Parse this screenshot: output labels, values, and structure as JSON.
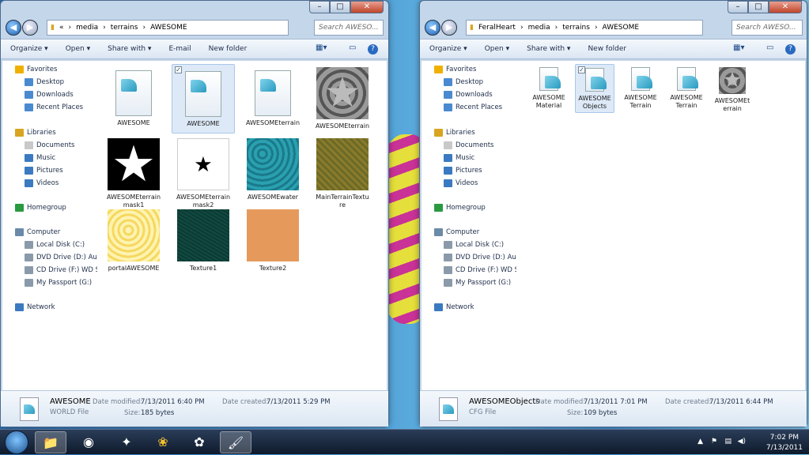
{
  "left": {
    "path": [
      "«",
      "media",
      "terrains",
      "AWESOME"
    ],
    "search_placeholder": "Search AWESO...",
    "toolbar": {
      "organize": "Organize ▾",
      "open": "Open ▾",
      "share": "Share with ▾",
      "email": "E-mail",
      "newfolder": "New folder"
    },
    "nav": {
      "favorites": "Favorites",
      "desktop": "Desktop",
      "downloads": "Downloads",
      "recent": "Recent Places",
      "libraries": "Libraries",
      "documents": "Documents",
      "music": "Music",
      "pictures": "Pictures",
      "videos": "Videos",
      "homegroup": "Homegroup",
      "computer": "Computer",
      "localdisk": "Local Disk (C:)",
      "dvd": "DVD Drive (D:) Audi",
      "cd": "CD Drive (F:) WD Sm",
      "passport": "My Passport (G:)",
      "network": "Network"
    },
    "files": [
      {
        "name": "AWESOME",
        "type": "doc"
      },
      {
        "name": "AWESOME",
        "type": "doc"
      },
      {
        "name": "AWESOMEterrain",
        "type": "doc"
      },
      {
        "name": "AWESOMEterrain",
        "type": "stars"
      },
      {
        "name": "AWESOMEterrain\nmask1",
        "type": "bigstar"
      },
      {
        "name": "AWESOMEterrain\nmask2",
        "type": "smallstar"
      },
      {
        "name": "AWESOMEwater",
        "type": "water"
      },
      {
        "name": "MainTerrainTextu\nre",
        "type": "grass"
      },
      {
        "name": "portalAWESOME",
        "type": "portal"
      },
      {
        "name": "Texture1",
        "type": "darkteal"
      },
      {
        "name": "Texture2",
        "type": "orange"
      }
    ],
    "details": {
      "name": "AWESOME",
      "type": "WORLD File",
      "modified_label": "Date modified:",
      "modified": "7/13/2011 6:40 PM",
      "created_label": "Date created:",
      "created": "7/13/2011 5:29 PM",
      "size_label": "Size:",
      "size": "185 bytes"
    }
  },
  "right": {
    "path": [
      "FeralHeart",
      "media",
      "terrains",
      "AWESOME"
    ],
    "search_placeholder": "Search AWESO...",
    "toolbar": {
      "organize": "Organize ▾",
      "open": "Open ▾",
      "share": "Share with ▾",
      "newfolder": "New folder"
    },
    "nav": {
      "favorites": "Favorites",
      "desktop": "Desktop",
      "downloads": "Downloads",
      "recent": "Recent Places",
      "libraries": "Libraries",
      "documents": "Documents",
      "music": "Music",
      "pictures": "Pictures",
      "videos": "Videos",
      "homegroup": "Homegroup",
      "computer": "Computer",
      "localdisk": "Local Disk (C:)",
      "dvd": "DVD Drive (D:) Audi",
      "cd": "CD Drive (F:) WD Sm",
      "passport": "My Passport (G:)",
      "network": "Network"
    },
    "files": [
      {
        "name": "AWESOME\nMaterial",
        "type": "doc"
      },
      {
        "name": "AWESOME\nObjects",
        "type": "doc"
      },
      {
        "name": "AWESOME\nTerrain",
        "type": "doc"
      },
      {
        "name": "AWESOME\nTerrain",
        "type": "doc"
      },
      {
        "name": "AWESOMEt\nerrain",
        "type": "stars"
      }
    ],
    "details": {
      "name": "AWESOMEObjects",
      "type": "CFG File",
      "modified_label": "Date modified:",
      "modified": "7/13/2011 7:01 PM",
      "created_label": "Date created:",
      "created": "7/13/2011 6:44 PM",
      "size_label": "Size:",
      "size": "109 bytes"
    }
  },
  "taskbar": {
    "time": "7:02 PM",
    "date": "7/13/2011"
  },
  "caption": {
    "min": "–",
    "max": "□",
    "close": "✕"
  }
}
